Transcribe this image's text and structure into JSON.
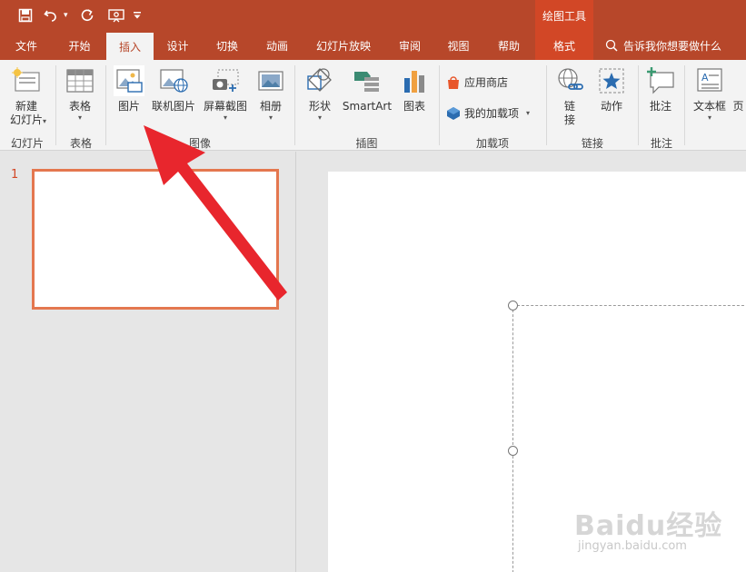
{
  "title_bar": {
    "context_header": "绘图工具",
    "qat": [
      "save-icon",
      "undo-icon",
      "redo-icon",
      "present-icon",
      "customize-icon"
    ]
  },
  "tabs": [
    {
      "label": "文件"
    },
    {
      "label": "开始"
    },
    {
      "label": "插入"
    },
    {
      "label": "设计"
    },
    {
      "label": "切换"
    },
    {
      "label": "动画"
    },
    {
      "label": "幻灯片放映"
    },
    {
      "label": "审阅"
    },
    {
      "label": "视图"
    },
    {
      "label": "帮助"
    },
    {
      "label": "格式"
    }
  ],
  "tell_me": "告诉我你想要做什么",
  "ribbon": {
    "slides": {
      "new_slide_line1": "新建",
      "new_slide_line2": "幻灯片",
      "group": "幻灯片"
    },
    "tables": {
      "table": "表格",
      "group": "表格"
    },
    "images": {
      "picture": "图片",
      "online_picture": "联机图片",
      "screenshot": "屏幕截图",
      "album": "相册",
      "group": "图像"
    },
    "illustrations": {
      "shapes": "形状",
      "smartart": "SmartArt",
      "chart": "图表",
      "group": "插图"
    },
    "addins": {
      "store": "应用商店",
      "my_addins": "我的加载项",
      "group": "加载项"
    },
    "links": {
      "link_line1": "链",
      "link_line2": "接",
      "action": "动作",
      "group": "链接"
    },
    "comments": {
      "comment": "批注",
      "group": "批注"
    },
    "text": {
      "textbox": "文本框",
      "header": "页"
    }
  },
  "slides_panel": {
    "slide_number": "1"
  },
  "watermark": {
    "logo": "Baidu经验",
    "url": "jingyan.baidu.com"
  },
  "colors": {
    "brand": "#b7472a",
    "context_tab": "#d24726",
    "arrow": "#e8262d",
    "thumb_border": "#e4774f"
  }
}
